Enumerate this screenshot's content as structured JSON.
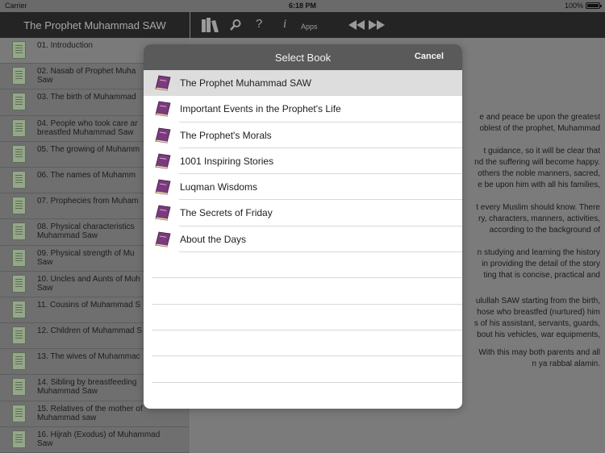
{
  "status": {
    "carrier": "Carrier",
    "time": "6:18 PM",
    "battery": "100%"
  },
  "left_bar": {
    "title": "The Prophet Muhammad SAW"
  },
  "toolbar": {
    "apps_label": "Apps",
    "help_label": "?",
    "info_label": "i"
  },
  "chapters": [
    "01. Introduction",
    "02. Nasab of Prophet Muha\nSaw",
    "03. The birth of Muhammad",
    "04. People who took care ar\nbreastfed Muhammad Saw",
    "05. The growing of Muhamm",
    "06. The names of Muhamm",
    "07. Prophecies from Muham",
    "08. Physical characteristics\nMuhammad Saw",
    "09. Physical strength of Mu\nSaw",
    "10. Uncles and Aunts of Muh\nSaw",
    "11. Cousins of Muhammad S",
    "12. Children of Muhammad S",
    "13. The wives of Muhammac",
    "14. Sibling by breastfeeding\nMuhammad Saw",
    "15. Relatives of the mother of\nMuhammad saw",
    "16. Hijrah (Exodus) of Muhammad\nSaw"
  ],
  "content": {
    "p1": "e and peace be upon the greatest\noblest of the prophet, Muhammad",
    "p2": "t guidance, so it will be clear that\nnd the suffering will become happy.\nothers the noble manners, sacred,\ne be upon him with all his families,",
    "p3": "t every Muslim should know. There\nry, characters, manners, activities,\naccording to the background of",
    "p4": "n studying and learning the history\nin providing the detail of the story\nting that is concise, practical and",
    "p5": "ulullah SAW starting from the birth,\nhose who breastfed (nurtured) him\ns of his assistant, servants, guards,\nbout his vehicles, war equipments,",
    "p6": "With this may both parents and all\nn ya rabbal alamin."
  },
  "modal": {
    "title": "Select Book",
    "cancel_label": "Cancel",
    "books": [
      "The Prophet Muhammad SAW",
      "Important Events in the Prophet's Life",
      "The Prophet's Morals",
      "1001 Inspiring Stories",
      "Luqman Wisdoms",
      "The Secrets of Friday",
      "About the Days"
    ]
  },
  "colors": {
    "book_icon": "#7b3a7e",
    "nav_bar": "#242424"
  }
}
